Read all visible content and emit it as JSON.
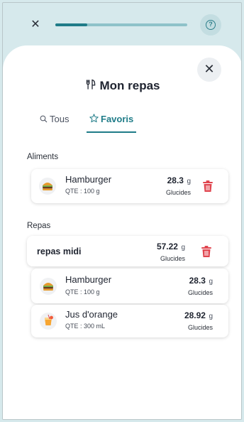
{
  "topbar": {
    "close_label": "✕",
    "progress": 0.24,
    "help_label": "?"
  },
  "sheet": {
    "close_label": "✕",
    "title": "Mon repas",
    "tabs": [
      {
        "label": "Tous",
        "active": false
      },
      {
        "label": "Favoris",
        "active": true
      }
    ]
  },
  "aliments": {
    "section_label": "Aliments",
    "items": [
      {
        "name": "Hamburger",
        "qty": "QTE : 100 g",
        "value": "28.3",
        "unit": "g",
        "value_label": "Glucides",
        "icon": "hamburger-icon"
      }
    ]
  },
  "repas": {
    "section_label": "Repas",
    "groups": [
      {
        "name": "repas midi",
        "value": "57.22",
        "unit": "g",
        "value_label": "Glucides",
        "items": [
          {
            "name": "Hamburger",
            "qty": "QTE : 100 g",
            "value": "28.3",
            "unit": "g",
            "value_label": "Glucides",
            "icon": "hamburger-icon"
          },
          {
            "name": "Jus d'orange",
            "qty": "QTE : 300 mL",
            "value": "28.92",
            "unit": "g",
            "value_label": "Glucides",
            "icon": "orange-juice-icon"
          }
        ]
      }
    ]
  },
  "colors": {
    "header_bg": "#d6e9ec",
    "accent": "#1f7c88",
    "progress_track": "#8ec2c9",
    "delete": "#e0454f",
    "sheet_bg": "#ffffff"
  }
}
